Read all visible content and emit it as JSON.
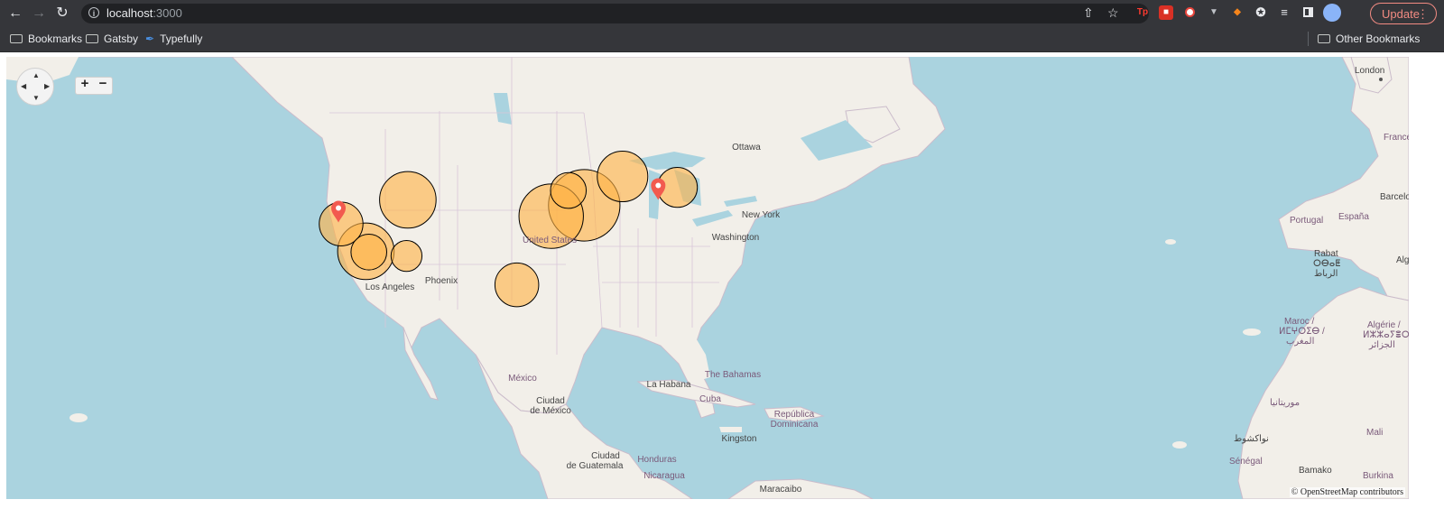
{
  "browser": {
    "url_host": "localhost",
    "url_port": ":3000",
    "update_label": "Update",
    "bookmarks": [
      {
        "label": "Bookmarks",
        "icon": "folder-icon"
      },
      {
        "label": "Gatsby",
        "icon": "folder-icon"
      },
      {
        "label": "Typefully",
        "icon": "feather-icon"
      }
    ],
    "other_bookmarks": "Other Bookmarks",
    "extensions": [
      "tp-icon",
      "ext-red-icon",
      "record-icon",
      "vee-icon",
      "fox-icon",
      "puzzle-icon",
      "queue-icon",
      "sidepanel-icon"
    ]
  },
  "map": {
    "attribution": "© OpenStreetMap contributors",
    "zoom_in": "+",
    "zoom_out": "−",
    "labels": {
      "london": "London",
      "france": "France",
      "barcelona": "Barcelo",
      "espana": "España",
      "portugal": "Portugal",
      "rabat": "Rabat",
      "rabat_amz": "ⵔⴱⴰⵟ",
      "rabat_ar": "الرباط",
      "alg": "Alg",
      "maroc": "Maroc /",
      "maroc_amz": "ⵍⵎⵖⵔⵉⴱ /",
      "maroc_ar": "المغرب",
      "algerie": "Algérie /",
      "algerie_amz": "ⵍⵣⵣⴰⵢⴻⵔ /",
      "algerie_ar": "الجزائر",
      "mauritania": "موريتانيا",
      "nouakchott": "نواكشوط",
      "mali": "Mali",
      "senegal": "Sénégal",
      "bamako": "Bamako",
      "burkina": "Burkina",
      "ottawa": "Ottawa",
      "new_york": "New York",
      "washington": "Washington",
      "united_states": "United States",
      "los_angeles": "Los Angeles",
      "phoenix": "Phoenix",
      "mexico": "México",
      "ciudad_mexico_1": "Ciudad",
      "ciudad_mexico_2": "de México",
      "la_habana": "La Habana",
      "cuba": "Cuba",
      "bahamas": "The Bahamas",
      "rep_dom_1": "República",
      "rep_dom_2": "Dominicana",
      "kingston": "Kingston",
      "ciudad_guatemala_1": "Ciudad",
      "ciudad_guatemala_2": "de Guatemala",
      "honduras": "Honduras",
      "nicaragua": "Nicaragua",
      "maracaibo": "Maracaibo"
    },
    "bubble_color": "#ffb347",
    "marker_color": "#f25a4f",
    "bubbles": [
      {
        "name": "bay-area",
        "lon": -122.0,
        "lat": 37.6,
        "size": 3
      },
      {
        "name": "los-angeles-large",
        "lon": -118.25,
        "lat": 34.1,
        "size": 5
      },
      {
        "name": "los-angeles-small",
        "lon": -117.8,
        "lat": 34.0,
        "size": 2
      },
      {
        "name": "salt-lake",
        "lon": -111.9,
        "lat": 40.7,
        "size": 5
      },
      {
        "name": "phoenix",
        "lon": -112.1,
        "lat": 33.5,
        "size": 1.5
      },
      {
        "name": "chicago",
        "lon": -87.6,
        "lat": 41.9,
        "size": 2
      },
      {
        "name": "indiana",
        "lon": -85.2,
        "lat": 40.0,
        "size": 8
      },
      {
        "name": "st-louis",
        "lon": -90.2,
        "lat": 38.6,
        "size": 6.5
      },
      {
        "name": "houston",
        "lon": -95.4,
        "lat": 29.8,
        "size": 3
      },
      {
        "name": "toronto",
        "lon": -79.4,
        "lat": 43.7,
        "size": 4
      },
      {
        "name": "boston",
        "lon": -71.1,
        "lat": 42.3,
        "size": 2.5
      }
    ],
    "markers": [
      {
        "name": "san-francisco",
        "lon": -122.4,
        "lat": 37.8
      },
      {
        "name": "new-york",
        "lon": -74.0,
        "lat": 40.7
      }
    ]
  }
}
